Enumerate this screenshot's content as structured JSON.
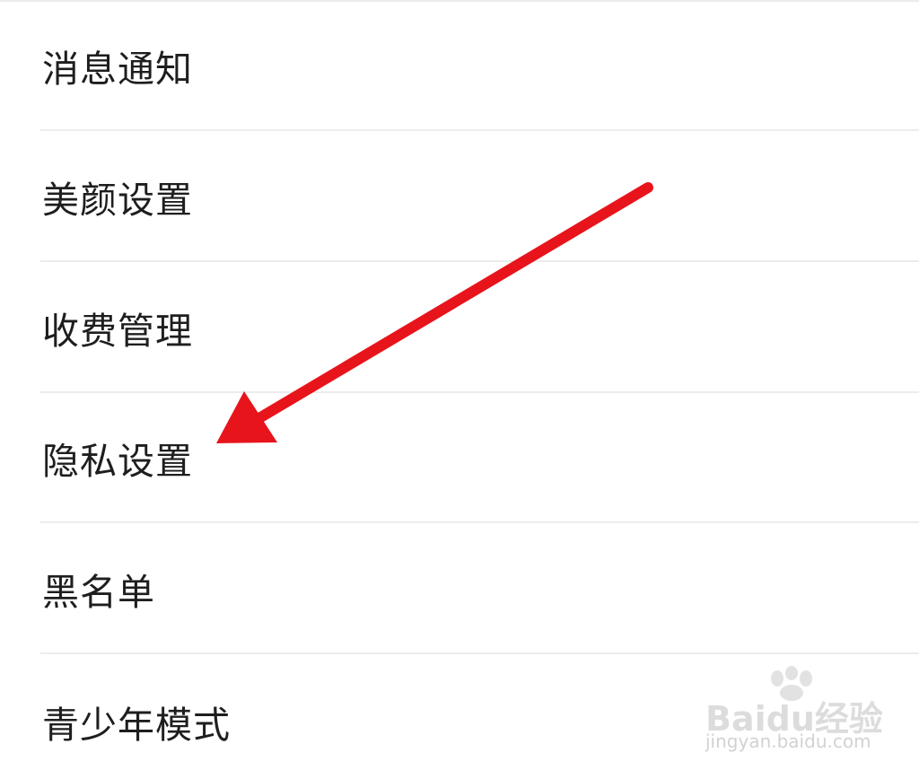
{
  "settings": {
    "items": [
      {
        "label": "消息通知"
      },
      {
        "label": "美颜设置"
      },
      {
        "label": "收费管理"
      },
      {
        "label": "隐私设置"
      },
      {
        "label": "黑名单"
      },
      {
        "label": "青少年模式"
      }
    ]
  },
  "annotation": {
    "arrow_color": "#e8141b",
    "points_to": "隐私设置"
  },
  "watermark": {
    "brand": "Baidu经验",
    "url": "jingyan.baidu.com"
  }
}
